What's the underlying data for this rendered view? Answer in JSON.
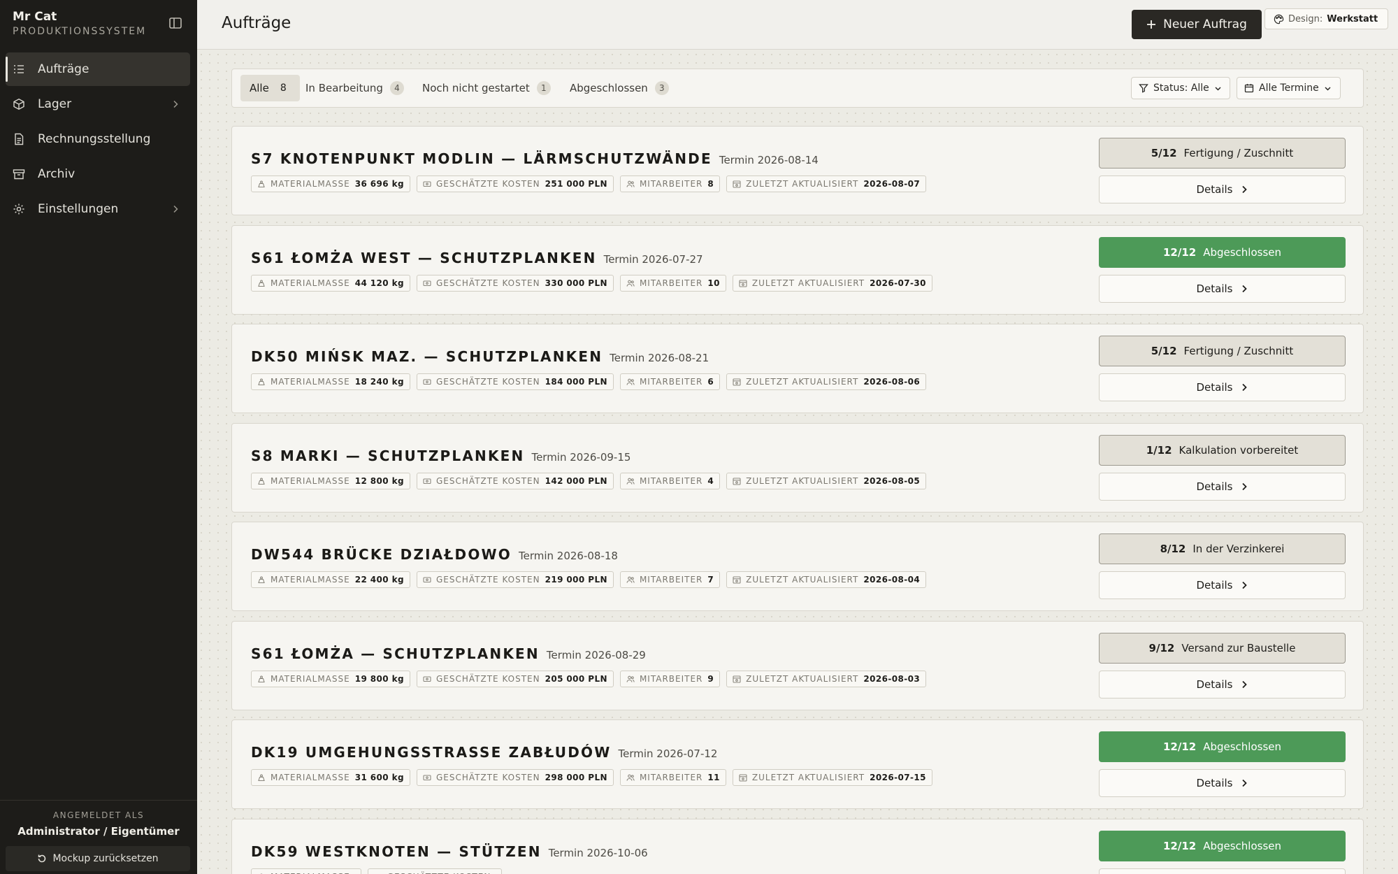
{
  "sidebar": {
    "brand_name": "Mr Cat",
    "brand_sub": "PRODUKTIONSSYSTEM",
    "items": [
      {
        "label": "Aufträge",
        "icon": "list-check-icon",
        "active": true,
        "has_chevron": false
      },
      {
        "label": "Lager",
        "icon": "box-icon",
        "active": false,
        "has_chevron": true
      },
      {
        "label": "Rechnungsstellung",
        "icon": "document-icon",
        "active": false,
        "has_chevron": false
      },
      {
        "label": "Archiv",
        "icon": "archive-icon",
        "active": false,
        "has_chevron": false
      },
      {
        "label": "Einstellungen",
        "icon": "gear-icon",
        "active": false,
        "has_chevron": true
      }
    ],
    "logged_in_label": "ANGEMELDET ALS",
    "logged_in_user": "Administrator / Eigentümer",
    "reset_label": "Mockup zurücksetzen"
  },
  "header": {
    "title": "Aufträge",
    "new_button": "Neuer Auftrag",
    "design_label": "Design:",
    "design_value": "Werkstatt"
  },
  "filters": {
    "tabs": [
      {
        "label": "Alle",
        "count": "8",
        "active": true
      },
      {
        "label": "In Bearbeitung",
        "count": "4",
        "active": false
      },
      {
        "label": "Noch nicht gestartet",
        "count": "1",
        "active": false
      },
      {
        "label": "Abgeschlossen",
        "count": "3",
        "active": false
      }
    ],
    "status_select": "Status: Alle",
    "date_select": "Alle Termine"
  },
  "meta_labels": {
    "mass": "MATERIALMASSE",
    "cost": "GESCHÄTZTE KOSTEN",
    "workers": "MITARBEITER",
    "updated": "ZULETZT AKTUALISIERT"
  },
  "details_label": "Details",
  "colors": {
    "done": "#4d9a58",
    "sidebar": "#1d1c19",
    "primary_button": "#2a2824"
  },
  "orders": [
    {
      "title": "S7 KNOTENPUNKT MODLIN — LÄRMSCHUTZWÄNDE",
      "deadline": "Termin 2026-08-14",
      "mass": "36 696 kg",
      "cost": "251 000 PLN",
      "workers": "8",
      "updated": "2026-08-07",
      "progress": "5/12",
      "status": "Fertigung / Zuschnitt",
      "done": false
    },
    {
      "title": "S61 ŁOMŻA WEST — SCHUTZPLANKEN",
      "deadline": "Termin 2026-07-27",
      "mass": "44 120 kg",
      "cost": "330 000 PLN",
      "workers": "10",
      "updated": "2026-07-30",
      "progress": "12/12",
      "status": "Abgeschlossen",
      "done": true
    },
    {
      "title": "DK50 MIŃSK MAZ. — SCHUTZPLANKEN",
      "deadline": "Termin 2026-08-21",
      "mass": "18 240 kg",
      "cost": "184 000 PLN",
      "workers": "6",
      "updated": "2026-08-06",
      "progress": "5/12",
      "status": "Fertigung / Zuschnitt",
      "done": false
    },
    {
      "title": "S8 MARKI — SCHUTZPLANKEN",
      "deadline": "Termin 2026-09-15",
      "mass": "12 800 kg",
      "cost": "142 000 PLN",
      "workers": "4",
      "updated": "2026-08-05",
      "progress": "1/12",
      "status": "Kalkulation vorbereitet",
      "done": false
    },
    {
      "title": "DW544 BRÜCKE DZIAŁDOWO",
      "deadline": "Termin 2026-08-18",
      "mass": "22 400 kg",
      "cost": "219 000 PLN",
      "workers": "7",
      "updated": "2026-08-04",
      "progress": "8/12",
      "status": "In der Verzinkerei",
      "done": false
    },
    {
      "title": "S61 ŁOMŻA — SCHUTZPLANKEN",
      "deadline": "Termin 2026-08-29",
      "mass": "19 800 kg",
      "cost": "205 000 PLN",
      "workers": "9",
      "updated": "2026-08-03",
      "progress": "9/12",
      "status": "Versand zur Baustelle",
      "done": false
    },
    {
      "title": "DK19 UMGEHUNGSSTRASSE ZABŁUDÓW",
      "deadline": "Termin 2026-07-12",
      "mass": "31 600 kg",
      "cost": "298 000 PLN",
      "workers": "11",
      "updated": "2026-07-15",
      "progress": "12/12",
      "status": "Abgeschlossen",
      "done": true
    },
    {
      "title": "DK59 WESTKNOTEN — STÜTZEN",
      "deadline": "Termin 2026-10-06",
      "mass": "",
      "cost": "",
      "workers": "",
      "updated": "",
      "progress": "12/12",
      "status": "Abgeschlossen",
      "done": true
    }
  ]
}
